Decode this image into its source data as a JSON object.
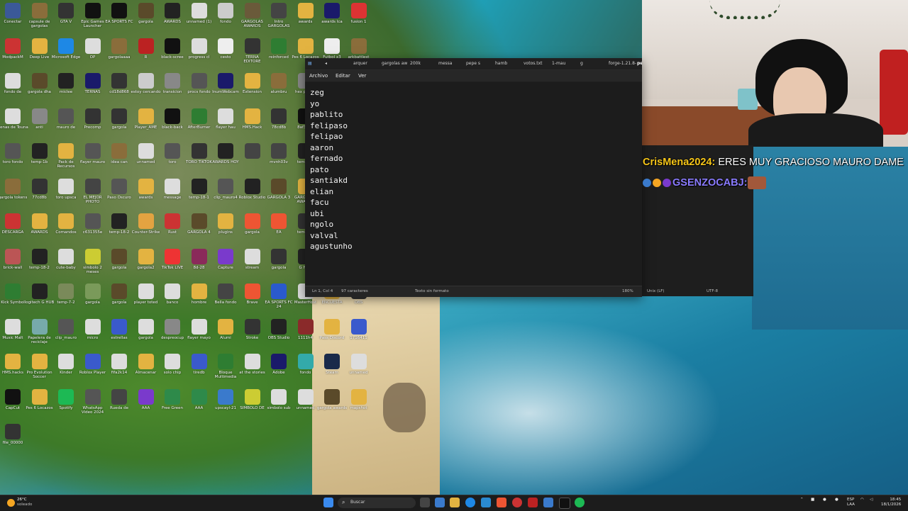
{
  "desktop": {
    "icons": [
      {
        "label": "Conectar",
        "c": "#3b5998"
      },
      {
        "label": "capsule de gargolas",
        "c": "#8a6d3b"
      },
      {
        "label": "GTA V",
        "c": "#333"
      },
      {
        "label": "Epic Games Launcher",
        "c": "#111"
      },
      {
        "label": "EA SPORTS FC",
        "c": "#111"
      },
      {
        "label": "gargola",
        "c": "#5a4a2a"
      },
      {
        "label": "AWARDS",
        "c": "#222"
      },
      {
        "label": "unnamed (1)",
        "c": "#ddd"
      },
      {
        "label": "fondo",
        "c": "#ccc"
      },
      {
        "label": "GARGOLAS AWARDS",
        "c": "#6a5a3a"
      },
      {
        "label": "Intro GARGOLAS",
        "c": "#444"
      },
      {
        "label": "awards",
        "c": "#e3b341"
      },
      {
        "label": "awards lca",
        "c": "#1a1a6a"
      },
      {
        "label": "fusion 1",
        "c": "#d33"
      },
      {
        "label": "ModpackM",
        "c": "#c33"
      },
      {
        "label": "Deep Live",
        "c": "#e3b341"
      },
      {
        "label": "Microsoft Edge",
        "c": "#1e88e5"
      },
      {
        "label": "OP",
        "c": "#ddd"
      },
      {
        "label": "gargolaaaa",
        "c": "#8a6d3b"
      },
      {
        "label": "R",
        "c": "#b22"
      },
      {
        "label": "black-scree",
        "c": "#111"
      },
      {
        "label": "progress cl",
        "c": "#ddd"
      },
      {
        "label": "cesto",
        "c": "#eee"
      },
      {
        "label": "TERNA EDITORE",
        "c": "#333"
      },
      {
        "label": "reinforced",
        "c": "#2e7d32"
      },
      {
        "label": "Pes 6 Locazos",
        "c": "#e3b341"
      },
      {
        "label": "Futbol x3 Basinga fno",
        "c": "#eee"
      },
      {
        "label": "arkbattlest",
        "c": "#8a6d3b"
      },
      {
        "label": "fondo de",
        "c": "#ddd"
      },
      {
        "label": "gargola dha",
        "c": "#5a4a2a"
      },
      {
        "label": "miclee",
        "c": "#222"
      },
      {
        "label": "TERNAS",
        "c": "#1a1a6a"
      },
      {
        "label": "cd18d868",
        "c": "#333"
      },
      {
        "label": "estoy cercando",
        "c": "#ccc"
      },
      {
        "label": "transicion",
        "c": "#888"
      },
      {
        "label": "procs fondo",
        "c": "#555"
      },
      {
        "label": "InumWebcam",
        "c": "#1a1a6a"
      },
      {
        "label": "Extension",
        "c": "#e3b341"
      },
      {
        "label": "alumbru",
        "c": "#8a6d3b"
      },
      {
        "label": "hex player",
        "c": "#888"
      },
      {
        "label": "GOLD",
        "c": "#5a4a2a"
      },
      {
        "label": "063ba4d8",
        "c": "#333"
      },
      {
        "label": "Cenas de Touna",
        "c": "#ddd"
      },
      {
        "label": "anti",
        "c": "#888"
      },
      {
        "label": "mauro de",
        "c": "#555"
      },
      {
        "label": "Precomp",
        "c": "#333"
      },
      {
        "label": "gargola",
        "c": "#333"
      },
      {
        "label": "Player_AME",
        "c": "#e3b341"
      },
      {
        "label": "black-back",
        "c": "#111"
      },
      {
        "label": "AfterBurner",
        "c": "#2e7d32"
      },
      {
        "label": "flayer hau",
        "c": "#ddd"
      },
      {
        "label": "HMS.Hack",
        "c": "#e3b341"
      },
      {
        "label": "78cd8b",
        "c": "#333"
      },
      {
        "label": "8af3b66",
        "c": "#111"
      },
      {
        "label": "live_upscay",
        "c": "#ddd"
      },
      {
        "label": "TOP DONADOR",
        "c": "#333"
      },
      {
        "label": "toro fondo",
        "c": "#555"
      },
      {
        "label": "temp-1b",
        "c": "#222"
      },
      {
        "label": "Pack de Recursos",
        "c": "#e3b341"
      },
      {
        "label": "flayer mauro",
        "c": "#555"
      },
      {
        "label": "idea can",
        "c": "#8a6d3b"
      },
      {
        "label": "unnamed",
        "c": "#ddd"
      },
      {
        "label": "toro",
        "c": "#555"
      },
      {
        "label": "TORO TIKTOK",
        "c": "#333"
      },
      {
        "label": "AWARDS HOY",
        "c": "#222"
      },
      {
        "label": "",
        "c": "#444"
      },
      {
        "label": "mvnh03v",
        "c": "#444"
      },
      {
        "label": "temp-18",
        "c": "#222"
      },
      {
        "label": "clip_mauro4",
        "c": "#555"
      },
      {
        "label": "gargola",
        "c": "#5a4a2a"
      },
      {
        "label": "gargola tokens",
        "c": "#8a6d3b"
      },
      {
        "label": "77cd8b",
        "c": "#333"
      },
      {
        "label": "toro upsca",
        "c": "#ddd"
      },
      {
        "label": "EL MEJOR PHOTO",
        "c": "#444"
      },
      {
        "label": "Paso Oscuro",
        "c": "#555"
      },
      {
        "label": "awards",
        "c": "#e3b341"
      },
      {
        "label": "message",
        "c": "#ddd"
      },
      {
        "label": "temp-18-1",
        "c": "#222"
      },
      {
        "label": "clip_mauro4",
        "c": "#555"
      },
      {
        "label": "Roblox Studio",
        "c": "#222"
      },
      {
        "label": "GARGOLA 3",
        "c": "#5a4a2a"
      },
      {
        "label": "GARGOLAS AWARSD",
        "c": "#e3b341"
      },
      {
        "label": "unnamed (1)",
        "c": "#ddd"
      },
      {
        "label": "TikTok",
        "c": "#111"
      },
      {
        "label": "DESCARGA",
        "c": "#c33"
      },
      {
        "label": "AWARDS",
        "c": "#e3b341"
      },
      {
        "label": "Comandos",
        "c": "#e3b341"
      },
      {
        "label": "c631355e",
        "c": "#555"
      },
      {
        "label": "temp-18-2",
        "c": "#222"
      },
      {
        "label": "Counter-Strike",
        "c": "#e3a341"
      },
      {
        "label": "Rust",
        "c": "#c33"
      },
      {
        "label": "GARGOLA 4",
        "c": "#5a4a2a"
      },
      {
        "label": "plugins",
        "c": "#e3b341"
      },
      {
        "label": "gargola",
        "c": "#e53"
      },
      {
        "label": "EA",
        "c": "#e53"
      },
      {
        "label": "temp-tik",
        "c": "#333"
      },
      {
        "label": "player miguel",
        "c": "#e3b341"
      },
      {
        "label": "Upscayl",
        "c": "#3a7acc"
      },
      {
        "label": "brick-wall",
        "c": "#b55"
      },
      {
        "label": "temp-18-2",
        "c": "#222"
      },
      {
        "label": "cute-baby",
        "c": "#ddd"
      },
      {
        "label": "simbolo 2 meses",
        "c": "#cc3"
      },
      {
        "label": "gargola",
        "c": "#5a4a2a"
      },
      {
        "label": "gargola2",
        "c": "#e3b341"
      },
      {
        "label": "TikTok LIVE",
        "c": "#e33"
      },
      {
        "label": "8d-28",
        "c": "#8a2a5a"
      },
      {
        "label": "Capture",
        "c": "#7a3acc"
      },
      {
        "label": "stream",
        "c": "#ddd"
      },
      {
        "label": "gargola",
        "c": "#333"
      },
      {
        "label": "G HUB",
        "c": "#222"
      },
      {
        "label": "",
        "c": "#c33"
      },
      {
        "label": "fondo ebut",
        "c": "#111"
      },
      {
        "label": "Kick Symbol",
        "c": "#2e7d32"
      },
      {
        "label": "logitech G HUB",
        "c": "#222"
      },
      {
        "label": "temp-7-2",
        "c": "#7a8a5a"
      },
      {
        "label": "gargola",
        "c": "#7a9a5a"
      },
      {
        "label": "gargola",
        "c": "#5a4a2a"
      },
      {
        "label": "player toted",
        "c": "#ddd"
      },
      {
        "label": "banco",
        "c": "#ddd"
      },
      {
        "label": "hombre",
        "c": "#e3b341"
      },
      {
        "label": "Bella fondo",
        "c": "#444"
      },
      {
        "label": "Brave",
        "c": "#e53"
      },
      {
        "label": "EA SPORTS FC 24",
        "c": "#2a5acc"
      },
      {
        "label": "MasterHost",
        "c": "#ddd"
      },
      {
        "label": "ENCUESTA",
        "c": "#e3b341"
      },
      {
        "label": "OBS",
        "c": "#333"
      },
      {
        "label": "Music Malt",
        "c": "#ddd"
      },
      {
        "label": "Papelera de reciclaje",
        "c": "#7aa"
      },
      {
        "label": "clip_mauro",
        "c": "#555"
      },
      {
        "label": "micro",
        "c": "#ddd"
      },
      {
        "label": "estrellas",
        "c": "#3a5acc"
      },
      {
        "label": "gargola",
        "c": "#ddd"
      },
      {
        "label": "despreocup",
        "c": "#888"
      },
      {
        "label": "flayer mayo",
        "c": "#ddd"
      },
      {
        "label": "Alumi",
        "c": "#e3b341"
      },
      {
        "label": "Stroke",
        "c": "#333"
      },
      {
        "label": "OBS Studio",
        "c": "#222"
      },
      {
        "label": "1111h4",
        "c": "#8a2a2a"
      },
      {
        "label": "Pass Discord",
        "c": "#e3b341"
      },
      {
        "label": "1716411",
        "c": "#3a5acc"
      },
      {
        "label": "HMS.hacks",
        "c": "#e3b341"
      },
      {
        "label": "Pro Evolution Soccer",
        "c": "#e3b341"
      },
      {
        "label": "Kinder",
        "c": "#ddd"
      },
      {
        "label": "Roblox Player",
        "c": "#3a5acc"
      },
      {
        "label": "fifa2k14",
        "c": "#ddd"
      },
      {
        "label": "Almacenar",
        "c": "#e3b341"
      },
      {
        "label": "solo chip",
        "c": "#ddd"
      },
      {
        "label": "tiredb",
        "c": "#3a5acc"
      },
      {
        "label": "Bloque Multimedia",
        "c": "#2e7d32"
      },
      {
        "label": "at the stories",
        "c": "#ddd"
      },
      {
        "label": "Adobe",
        "c": "#1a1a6a"
      },
      {
        "label": "fondo",
        "c": "#3aa"
      },
      {
        "label": "Steam",
        "c": "#1a2a4a"
      },
      {
        "label": "unnamed",
        "c": "#ddd"
      },
      {
        "label": "CapCut",
        "c": "#111"
      },
      {
        "label": "Pes 6 Locazos",
        "c": "#e3b341"
      },
      {
        "label": "Spotify",
        "c": "#1db954"
      },
      {
        "label": "WhatsApp Video 2024",
        "c": "#555"
      },
      {
        "label": "Rueda de",
        "c": "#444"
      },
      {
        "label": "AAA",
        "c": "#7a3acc"
      },
      {
        "label": "Free Green",
        "c": "#2e8a4a"
      },
      {
        "label": "AAA",
        "c": "#2e8a4a"
      },
      {
        "label": "upscayl-21",
        "c": "#3a7acc"
      },
      {
        "label": "SIMBOLO DE",
        "c": "#cc3"
      },
      {
        "label": "simbolo sub",
        "c": "#ddd"
      },
      {
        "label": "unnamed",
        "c": "#ddd"
      },
      {
        "label": "gargola awards",
        "c": "#5a4a2a"
      },
      {
        "label": "mapshot",
        "c": "#e3b341"
      },
      {
        "label": "file_00000",
        "c": "#333"
      }
    ]
  },
  "notepad": {
    "tabs": [
      "◂",
      "arquer",
      "gargolas aw",
      "200k",
      "messa",
      "pepe s",
      "hamb",
      "votos.txt",
      "1-mau",
      "g",
      "forge-1.21.8-",
      "pe"
    ],
    "menu": [
      "Archivo",
      "Editar",
      "Ver"
    ],
    "lines": [
      "zeg",
      "yo",
      "pablito",
      "felipaso",
      "felipao",
      "aaron",
      "fernado",
      "pato",
      "santiakd",
      "elian",
      "facu",
      "ubi",
      "ngolo",
      "valval",
      "agustunho"
    ],
    "status": {
      "position": "Ln 1, Col 4",
      "chars": "97 caracteres",
      "format": "Texto sin formato",
      "zoom": "180%",
      "eol": "Unix (LF)",
      "encoding": "UTF-8"
    }
  },
  "chat": [
    {
      "user": "CrisMena2024:",
      "text": " ERES MUY GRACIOSO MAURO DAME",
      "user_color": "#f5c518"
    },
    {
      "user": "GSENZOCABJ:",
      "text": "",
      "user_color": "#8a7bff"
    }
  ],
  "taskbar": {
    "weather_temp": "26°C",
    "weather_cond": "soleado",
    "search_label": "Buscar",
    "lang": "ESP",
    "lang2": "LAA",
    "time": "18:45",
    "date": "18/1/2026"
  },
  "colors": {
    "notepad_bg": "#1c1c1c",
    "chat_user1": "#f5c518",
    "chat_user2": "#8a7bff"
  }
}
